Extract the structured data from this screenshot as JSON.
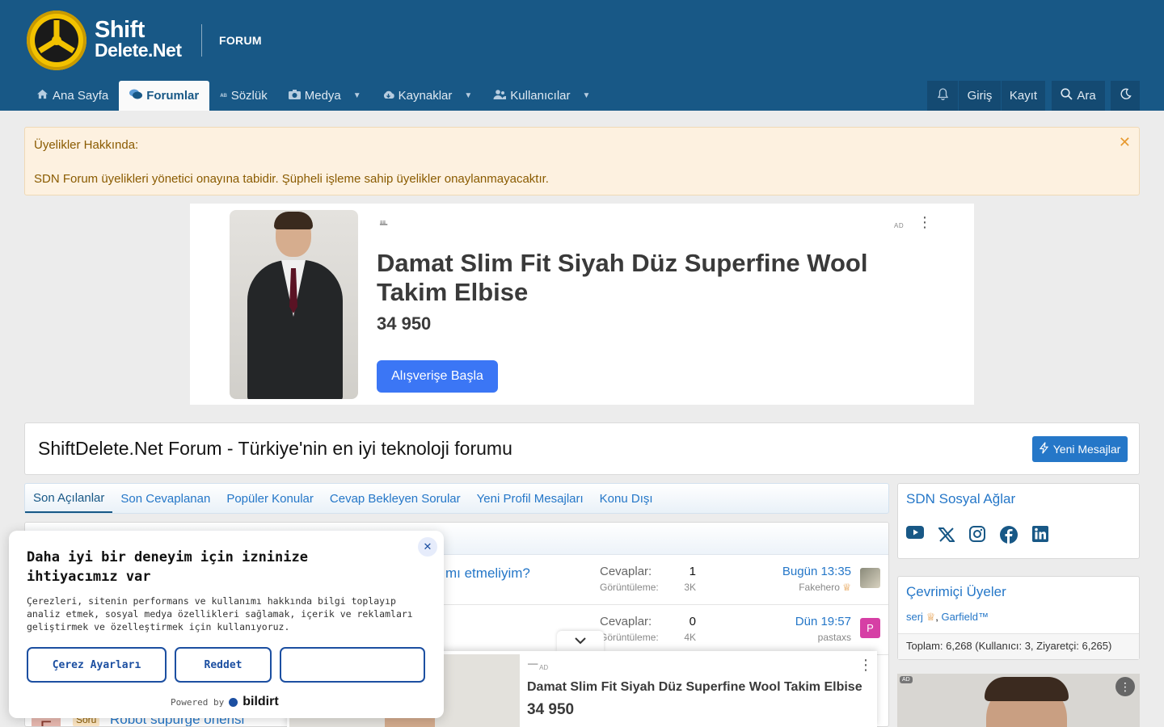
{
  "header": {
    "logo_line1": "Shift",
    "logo_line2": "Delete.Net",
    "section": "FORUM"
  },
  "nav": {
    "items": [
      {
        "label": "Ana Sayfa",
        "icon": "home-icon"
      },
      {
        "label": "Forumlar",
        "icon": "comments-icon",
        "active": true
      },
      {
        "label": "Sözlük",
        "icon": "dictionary-icon"
      },
      {
        "label": "Medya",
        "icon": "camera-icon",
        "dropdown": true
      },
      {
        "label": "Kaynaklar",
        "icon": "cloud-download-icon",
        "dropdown": true
      },
      {
        "label": "Kullanıcılar",
        "icon": "users-icon",
        "dropdown": true
      }
    ],
    "right": {
      "login": "Giriş",
      "register": "Kayıt",
      "search": "Ara"
    }
  },
  "notice": {
    "title": "Üyelikler Hakkında:",
    "text": "SDN Forum üyelikleri yönetici onayına tabidir. Şüpheli işleme sahip üyelikler onaylanmayacaktır."
  },
  "ad_top": {
    "badge": "AD",
    "title": "Damat Slim Fit Siyah Düz Superfine Wool Takim Elbise",
    "price": "34 950",
    "cta": "Alışverişe Başla"
  },
  "page": {
    "title": "ShiftDelete.Net Forum - Türkiye'nin en iyi teknoloji forumu",
    "new_posts": "Yeni Mesajlar"
  },
  "tabs": [
    "Son Açılanlar",
    "Son Cevaplanan",
    "Popüler Konular",
    "Cevap Bekleyen Sorular",
    "Yeni Profil Mesajları",
    "Konu Dışı"
  ],
  "threads": [
    {
      "title_fragment": "mı etmeliyim?",
      "replies_label": "Cevaplar:",
      "replies": "1",
      "views_label": "Görüntüleme:",
      "views": "3K",
      "when": "Bugün 13:35",
      "user": "Fakehero"
    },
    {
      "title_fragment": "",
      "replies_label": "Cevaplar:",
      "replies": "0",
      "views_label": "Görüntüleme:",
      "views": "4K",
      "when": "Dün 19:57",
      "user": "pastaxs",
      "avatar_letter": "P"
    },
    {
      "prefix": "Soru",
      "title": "Robot süpürge önerisi",
      "avatar_letter": "E"
    }
  ],
  "sidebar": {
    "social_title": "SDN Sosyal Ağlar",
    "social": [
      "youtube-icon",
      "x-icon",
      "instagram-icon",
      "facebook-icon",
      "linkedin-icon"
    ],
    "online_title": "Çevrimiçi Üyeler",
    "online_users": [
      "serj",
      "Garfield™"
    ],
    "online_total": "Toplam: 6,268 (Kullanıcı: 3, Ziyaretçi: 6,265)",
    "ad_badge": "AD"
  },
  "cookie": {
    "title": "Daha iyi bir deneyim için izninize ihtiyacımız var",
    "text": "Çerezleri, sitenin performans ve kullanımı hakkında bilgi toplayıp analiz etmek, sosyal medya özellikleri sağlamak, içerik ve reklamları geliştirmek ve özelleştirmek için kullanıyoruz.",
    "settings": "Çerez Ayarları",
    "reject": "Reddet",
    "powered_by": "Powered by",
    "powered_brand": "bildirt"
  },
  "ad_sticky": {
    "badge": "AD",
    "title": "Damat Slim Fit Siyah Düz Superfine Wool Takim Elbise",
    "price": "34 950"
  },
  "colors": {
    "header": "#185886",
    "link": "#2577c8",
    "accent_button": "#2577c8",
    "notice_bg": "#fdf1e0",
    "notice_text": "#8a5b00"
  }
}
